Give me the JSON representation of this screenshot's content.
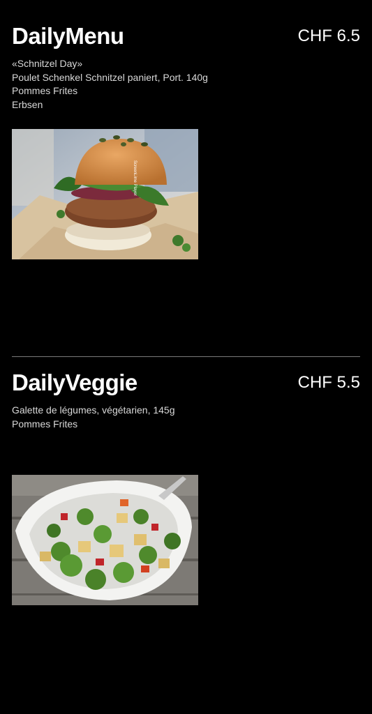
{
  "daily_menu": {
    "title": "DailyMenu",
    "price": "CHF 6.5",
    "lines": [
      "«Schnitzel Day»",
      "Poulet Schenkel Schnitzel paniert, Port. 140g",
      "Pommes Frites",
      "Erbsen"
    ],
    "image_icon": "burger-photo",
    "image_watermark": "ScreenLime Player"
  },
  "daily_veggie": {
    "title": "DailyVeggie",
    "price": "CHF 5.5",
    "lines": [
      "Galette de légumes, végétarien, 145g",
      "Pommes Frites"
    ],
    "image_icon": "vegetable-bowl-photo"
  },
  "colors": {
    "background": "#000000",
    "text": "#ffffff",
    "divider": "#7a7a7a"
  }
}
